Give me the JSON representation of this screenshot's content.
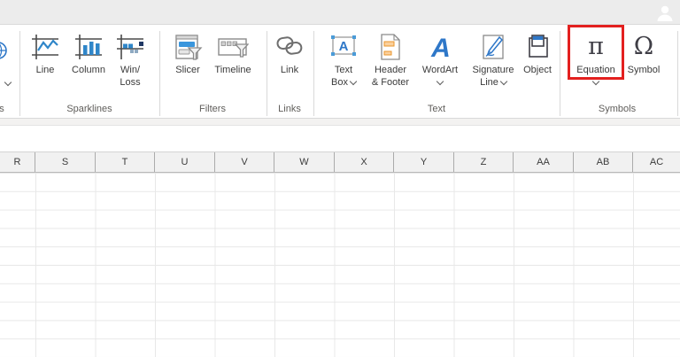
{
  "titlebar": {
    "account_icon": "person-silhouette"
  },
  "ribbon": {
    "clipped_group": {
      "label_fragment": "s"
    },
    "sparklines": {
      "group_label": "Sparklines",
      "line_label": "Line",
      "column_label": "Column",
      "winloss_label_1": "Win/",
      "winloss_label_2": "Loss"
    },
    "filters": {
      "group_label": "Filters",
      "slicer_label": "Slicer",
      "timeline_label": "Timeline"
    },
    "links": {
      "group_label": "Links",
      "link_label": "Link"
    },
    "text": {
      "group_label": "Text",
      "textbox_label_1": "Text",
      "textbox_label_2": "Box",
      "headerfooter_label_1": "Header",
      "headerfooter_label_2": "& Footer",
      "wordart_label": "WordArt",
      "signature_label_1": "Signature",
      "signature_label_2": "Line",
      "object_label": "Object"
    },
    "symbols": {
      "group_label": "Symbols",
      "equation_label": "Equation",
      "symbol_label": "Symbol"
    }
  },
  "icons": {
    "equation_glyph": "π",
    "symbol_glyph": "Ω",
    "wordart_glyph": "A",
    "textbox_glyph": "A"
  },
  "highlight": {
    "target": "equation-button",
    "color": "#e3201f"
  },
  "colors": {
    "accent_blue": "#2e77c8",
    "sparkline_blue": "#2f86c9",
    "icon_dark": "#3f3e46",
    "orange_fill": "#fbd09c",
    "orange_stroke": "#e8962e",
    "titlebar_bg": "#ececec",
    "header_bg": "#f1f1f1",
    "gridline": "#e8e8e8"
  },
  "sheet": {
    "columns": [
      "R",
      "S",
      "T",
      "U",
      "V",
      "W",
      "X",
      "Y",
      "Z",
      "AA",
      "AB",
      "AC"
    ]
  }
}
